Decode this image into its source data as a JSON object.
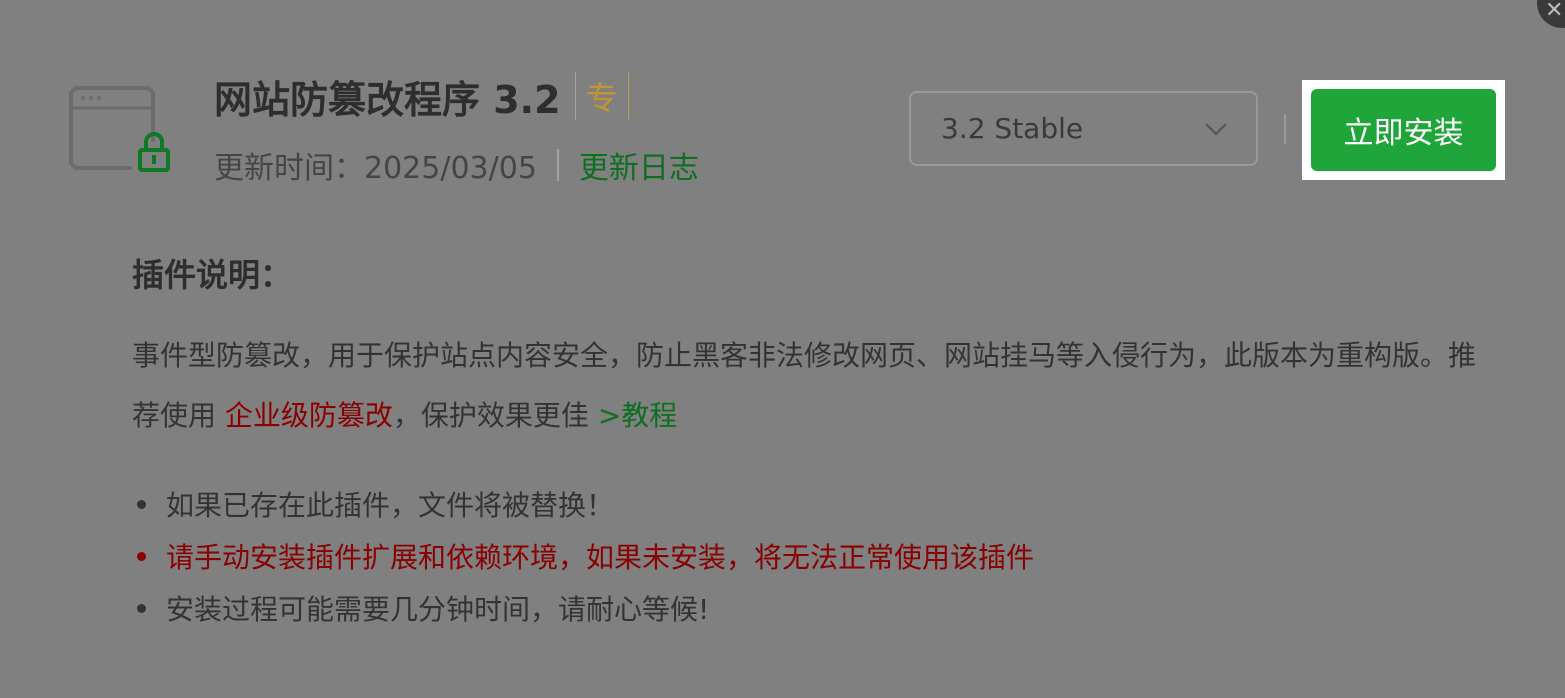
{
  "header": {
    "title": "网站防篡改程序 3.2",
    "pro_badge": "专",
    "update_label": "更新时间：2025/03/05",
    "changelog_link": "更新日志"
  },
  "controls": {
    "version_selected": "3.2 Stable",
    "install_button": "立即安装"
  },
  "description": {
    "heading": "插件说明：",
    "text_1": "事件型防篡改，用于保护站点内容安全，防止黑客非法修改网页、网站挂马等入侵行为，此版本为重构版。推荐使用 ",
    "link_enterprise": "企业级防篡改",
    "text_2": "，保护效果更佳 ",
    "link_tutorial": ">教程"
  },
  "notes": [
    {
      "text": "如果已存在此插件，文件将被替换！"
    },
    {
      "text": "请手动安装插件扩展和依赖环境，如果未安装，将无法正常使用该插件"
    },
    {
      "text": "安装过程可能需要几分钟时间，请耐心等候!"
    }
  ],
  "colors": {
    "install_green": "#20a53a",
    "link_green": "#0f6f21",
    "warn_red": "#8b0000",
    "pro_gold": "#c39630",
    "overlay_gray": "#808080"
  },
  "icons": {
    "plugin_icon": "browser-window-lock-icon",
    "select_chevron": "chevron-down-icon",
    "close": "close-icon"
  }
}
